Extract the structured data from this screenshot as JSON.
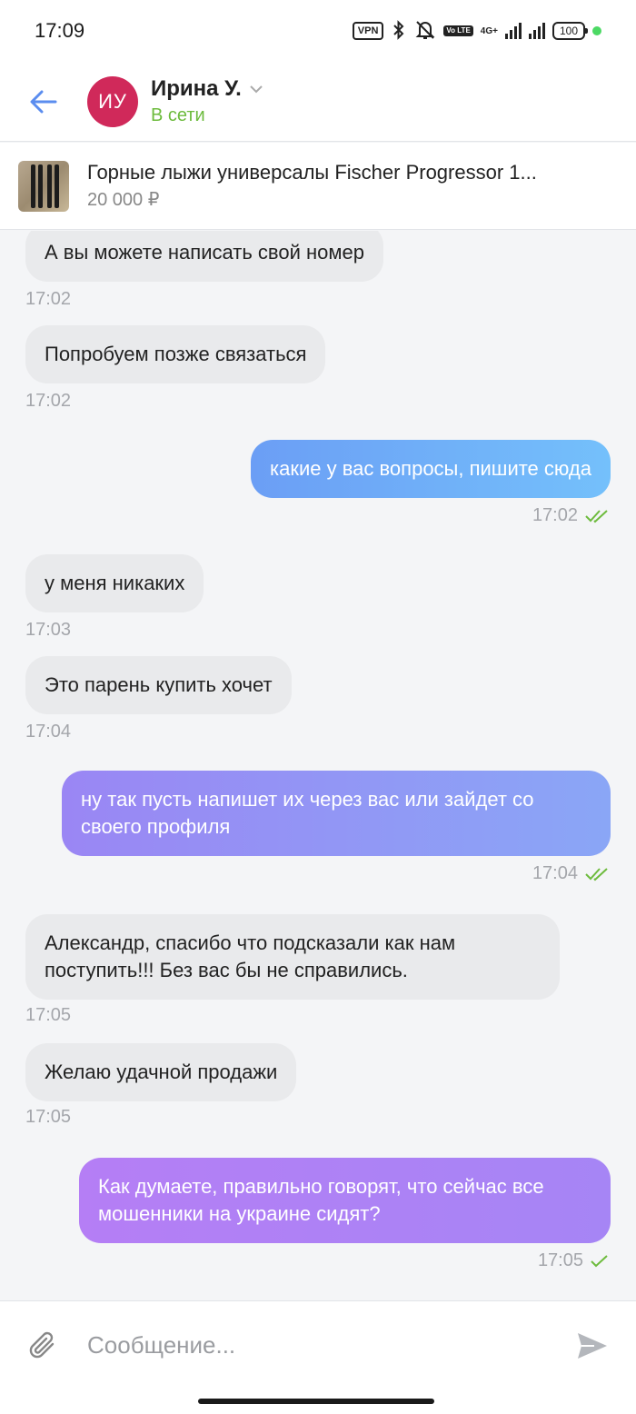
{
  "status_bar": {
    "time": "17:09",
    "vpn": "VPN",
    "volte": "Vo LTE",
    "network": "4G+",
    "battery": "100"
  },
  "header": {
    "avatar_initials": "ИУ",
    "name": "Ирина У.",
    "status": "В сети"
  },
  "product": {
    "title": "Горные лыжи универсалы Fischer Progressor 1...",
    "price": "20 000 ₽"
  },
  "messages": [
    {
      "dir": "in",
      "text": "А вы можете написать свой номер",
      "time": "17:02"
    },
    {
      "dir": "in",
      "text": "Попробуем позже связаться",
      "time": "17:02"
    },
    {
      "dir": "out",
      "text": "какие у вас вопросы, пишите сюда",
      "time": "17:02",
      "read": true
    },
    {
      "dir": "in",
      "text": "у меня никаких",
      "time": "17:03"
    },
    {
      "dir": "in",
      "text": "Это парень купить хочет",
      "time": "17:04"
    },
    {
      "dir": "out",
      "text": "ну так пусть напишет их через вас или зайдет со своего профиля",
      "time": "17:04",
      "read": true
    },
    {
      "dir": "in",
      "text": "Александр, спасибо что подсказали как нам поступить!!! Без вас бы не справились.",
      "time": "17:05"
    },
    {
      "dir": "in",
      "text": "Желаю удачной продажи",
      "time": "17:05"
    },
    {
      "dir": "out",
      "text": "Как думаете, правильно говорят, что сейчас все мошенники на украине сидят?",
      "time": "17:05",
      "read": false
    }
  ],
  "composer": {
    "placeholder": "Сообщение..."
  },
  "colors": {
    "accent_blue": "#5b8def",
    "online_green": "#6dbb3d",
    "avatar_bg": "#d0295a",
    "incoming_bubble": "#e9eaec",
    "check_green": "#6dbb3d"
  },
  "icons": {
    "back": "arrow-left-icon",
    "dropdown": "chevron-down-icon",
    "attach": "paperclip-icon",
    "send": "send-icon",
    "read_double": "double-check-icon",
    "sent_single": "check-icon"
  }
}
